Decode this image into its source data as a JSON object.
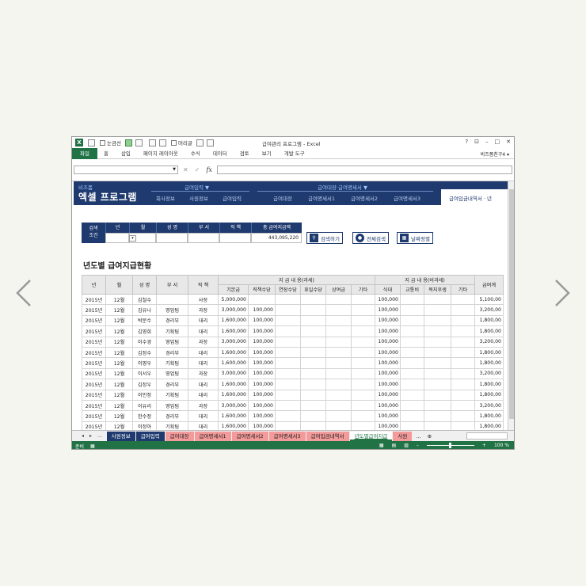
{
  "colors": {
    "excel_green": "#217346",
    "navy": "#1f3a6e",
    "pink_tab": "#f39a9a"
  },
  "titlebar": {
    "qa_labels": [
      "눈금선",
      "머리글"
    ],
    "title": "급여관리 프로그램 - Excel",
    "controls": [
      "?",
      "⊡",
      "–",
      "□",
      "✕"
    ]
  },
  "ribbon": {
    "tabs": [
      "파일",
      "홈",
      "삽입",
      "페이지 레이아웃",
      "수식",
      "데이터",
      "검토",
      "보기",
      "개발 도구"
    ],
    "user": "비즈폼친구4 ▾"
  },
  "formula": {
    "fx": "fx",
    "cancel": "✕",
    "enter": "✓"
  },
  "banner": {
    "brand_small": "비즈폼",
    "brand_big": "엑셀 프로그램",
    "groups": [
      {
        "title": "급여입력 ▼",
        "items": [
          "회사정보",
          "사원정보",
          "급여입력"
        ]
      },
      {
        "title": "급여대장·급여명세서 ▼",
        "items": [
          "급여대장",
          "급여명세서1",
          "급여명세서2",
          "급여명세서3"
        ]
      }
    ],
    "active_tab": "급여입금내역서 · 년"
  },
  "search": {
    "label_line1": "검색",
    "label_line2": "조건",
    "headers": [
      "년",
      "월",
      "성 명",
      "부 서",
      "직 책",
      "총 급여지급액"
    ],
    "total": "443,095,220",
    "buttons": [
      {
        "label": "검색하기",
        "icon": "search-icon"
      },
      {
        "label": "전체검색",
        "icon": "all-icon"
      },
      {
        "label": "날짜정렬",
        "icon": "calendar-icon"
      }
    ],
    "dropdown": "▾"
  },
  "section_title": "년도별 급여지급현황",
  "table": {
    "top_headers": [
      "년",
      "월",
      "성 명",
      "부 서",
      "직 책",
      "지 급 내 용(과세)",
      "지 급 내 용(비과세)",
      "급여계"
    ],
    "sub_taxable": [
      "기본급",
      "직책수당",
      "연장수당",
      "휴일수당",
      "상여금",
      "기타"
    ],
    "sub_nontaxable": [
      "식대",
      "교통비",
      "복지후생",
      "기타"
    ],
    "rows": [
      [
        "2015년",
        "12월",
        "김철수",
        "",
        "사장",
        "5,000,000",
        "",
        "",
        "",
        "",
        "",
        "100,000",
        "",
        "",
        "",
        "5,100,00"
      ],
      [
        "2015년",
        "12월",
        "김유나",
        "영업팀",
        "과장",
        "3,000,000",
        "100,000",
        "",
        "",
        "",
        "",
        "100,000",
        "",
        "",
        "",
        "3,200,00"
      ],
      [
        "2015년",
        "12월",
        "박문수",
        "경리부",
        "대리",
        "1,600,000",
        "100,000",
        "",
        "",
        "",
        "",
        "100,000",
        "",
        "",
        "",
        "1,800,00"
      ],
      [
        "2015년",
        "12월",
        "김영희",
        "기획팀",
        "대리",
        "1,600,000",
        "100,000",
        "",
        "",
        "",
        "",
        "100,000",
        "",
        "",
        "",
        "1,800,00"
      ],
      [
        "2015년",
        "12월",
        "이수경",
        "영업팀",
        "과장",
        "3,000,000",
        "100,000",
        "",
        "",
        "",
        "",
        "100,000",
        "",
        "",
        "",
        "3,200,00"
      ],
      [
        "2015년",
        "12월",
        "김정수",
        "경리부",
        "대리",
        "1,600,000",
        "100,000",
        "",
        "",
        "",
        "",
        "100,000",
        "",
        "",
        "",
        "1,800,00"
      ],
      [
        "2015년",
        "12월",
        "이영우",
        "기획팀",
        "대리",
        "1,600,000",
        "100,000",
        "",
        "",
        "",
        "",
        "100,000",
        "",
        "",
        "",
        "1,800,00"
      ],
      [
        "2015년",
        "12월",
        "이서우",
        "영업팀",
        "과장",
        "3,000,000",
        "100,000",
        "",
        "",
        "",
        "",
        "100,000",
        "",
        "",
        "",
        "3,200,00"
      ],
      [
        "2015년",
        "12월",
        "김정우",
        "경리부",
        "대리",
        "1,600,000",
        "100,000",
        "",
        "",
        "",
        "",
        "100,000",
        "",
        "",
        "",
        "1,800,00"
      ],
      [
        "2015년",
        "12월",
        "이민정",
        "기획팀",
        "대리",
        "1,600,000",
        "100,000",
        "",
        "",
        "",
        "",
        "100,000",
        "",
        "",
        "",
        "1,800,00"
      ],
      [
        "2015년",
        "12월",
        "이유리",
        "영업팀",
        "과장",
        "3,000,000",
        "100,000",
        "",
        "",
        "",
        "",
        "100,000",
        "",
        "",
        "",
        "3,200,00"
      ],
      [
        "2015년",
        "12월",
        "한수정",
        "경리부",
        "대리",
        "1,600,000",
        "100,000",
        "",
        "",
        "",
        "",
        "100,000",
        "",
        "",
        "",
        "1,800,00"
      ],
      [
        "2015년",
        "12월",
        "이정아",
        "기획팀",
        "대리",
        "1,600,000",
        "100,000",
        "",
        "",
        "",
        "",
        "100,000",
        "",
        "",
        "",
        "1,800,00"
      ]
    ]
  },
  "sheet_tabs": {
    "nav": [
      "◂",
      "▸",
      "..."
    ],
    "tabs": [
      {
        "label": "사원정보",
        "style": "navy"
      },
      {
        "label": "급여입력",
        "style": "navy"
      },
      {
        "label": "급여대장",
        "style": "pink"
      },
      {
        "label": "급여명세서1",
        "style": "pink"
      },
      {
        "label": "급여명세서2",
        "style": "pink"
      },
      {
        "label": "급여명세서3",
        "style": "pink"
      },
      {
        "label": "급여입금내역서",
        "style": "pink"
      },
      {
        "label": "년도별급여지급",
        "style": "active"
      },
      {
        "label": "사원",
        "style": "pink"
      }
    ],
    "more": "...",
    "add": "⊕"
  },
  "statusbar": {
    "ready": "준비",
    "zoom": "100 %"
  }
}
